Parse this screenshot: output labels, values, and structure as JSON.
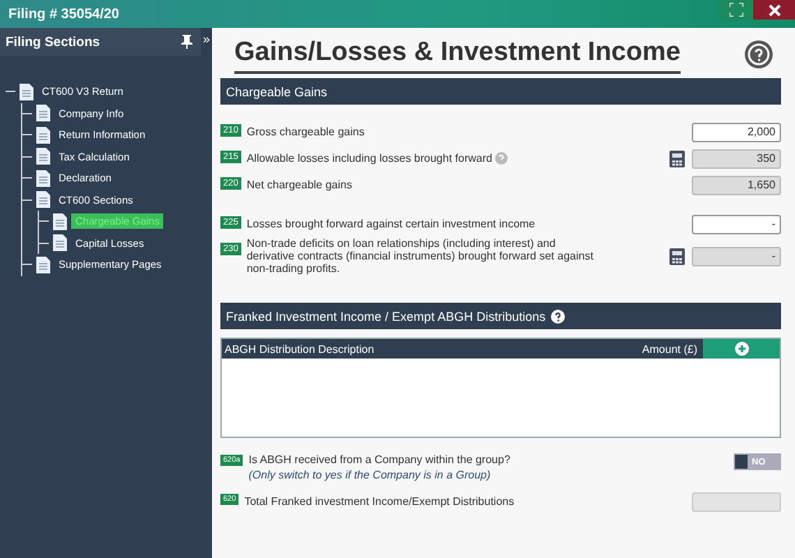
{
  "window": {
    "title": "Filing # 35054/20"
  },
  "sidebar": {
    "title": "Filing Sections",
    "collapse": "»",
    "tree": [
      {
        "label": "CT600 V3 Return",
        "selected": false,
        "children": [
          {
            "label": "Company Info",
            "selected": false
          },
          {
            "label": "Return Information",
            "selected": false
          },
          {
            "label": "Tax Calculation",
            "selected": false
          },
          {
            "label": "Declaration",
            "selected": false
          },
          {
            "label": "CT600 Sections",
            "selected": false,
            "children": [
              {
                "label": "Chargeable Gains",
                "selected": true
              },
              {
                "label": "Capital Losses",
                "selected": false
              }
            ]
          },
          {
            "label": "Supplementary Pages",
            "selected": false
          }
        ]
      }
    ]
  },
  "page": {
    "title": "Gains/Losses & Investment Income"
  },
  "chargeable_gains": {
    "heading": "Chargeable Gains",
    "rows": [
      {
        "code": "210",
        "label": "Gross chargeable gains",
        "help": false,
        "calculator": false,
        "readonly": false,
        "value": "2,000",
        "gap": false
      },
      {
        "code": "215",
        "label": "Allowable losses including losses brought forward",
        "help": true,
        "calculator": true,
        "readonly": true,
        "value": "350",
        "gap": false
      },
      {
        "code": "220",
        "label": "Net chargeable gains",
        "help": false,
        "calculator": false,
        "readonly": true,
        "value": "1,650",
        "gap": false
      },
      {
        "code": "225",
        "label": "Losses brought forward against certain investment income",
        "help": false,
        "calculator": false,
        "readonly": false,
        "value": "-",
        "gap": true
      },
      {
        "code": "230",
        "label": "Non-trade deficits on loan relationships (including interest) and derivative contracts (financial instruments) brought forward set against non-trading profits.",
        "help": false,
        "calculator": true,
        "readonly": true,
        "value": "-",
        "gap": false
      }
    ]
  },
  "franked": {
    "heading": "Franked Investment Income / Exempt ABGH Distributions",
    "help": true,
    "table": {
      "columns": [
        "ABGH Distribution Description",
        "Amount (£)"
      ]
    },
    "group_question": {
      "code": "620a",
      "label": "Is ABGH received from a Company within the group?",
      "note": "(Only switch to yes if the Company is in a Group)",
      "on": false,
      "toggle_label": "NO"
    },
    "total": {
      "code": "620",
      "label": "Total Franked investment Income/Exempt Distributions",
      "readonly": true
    }
  }
}
